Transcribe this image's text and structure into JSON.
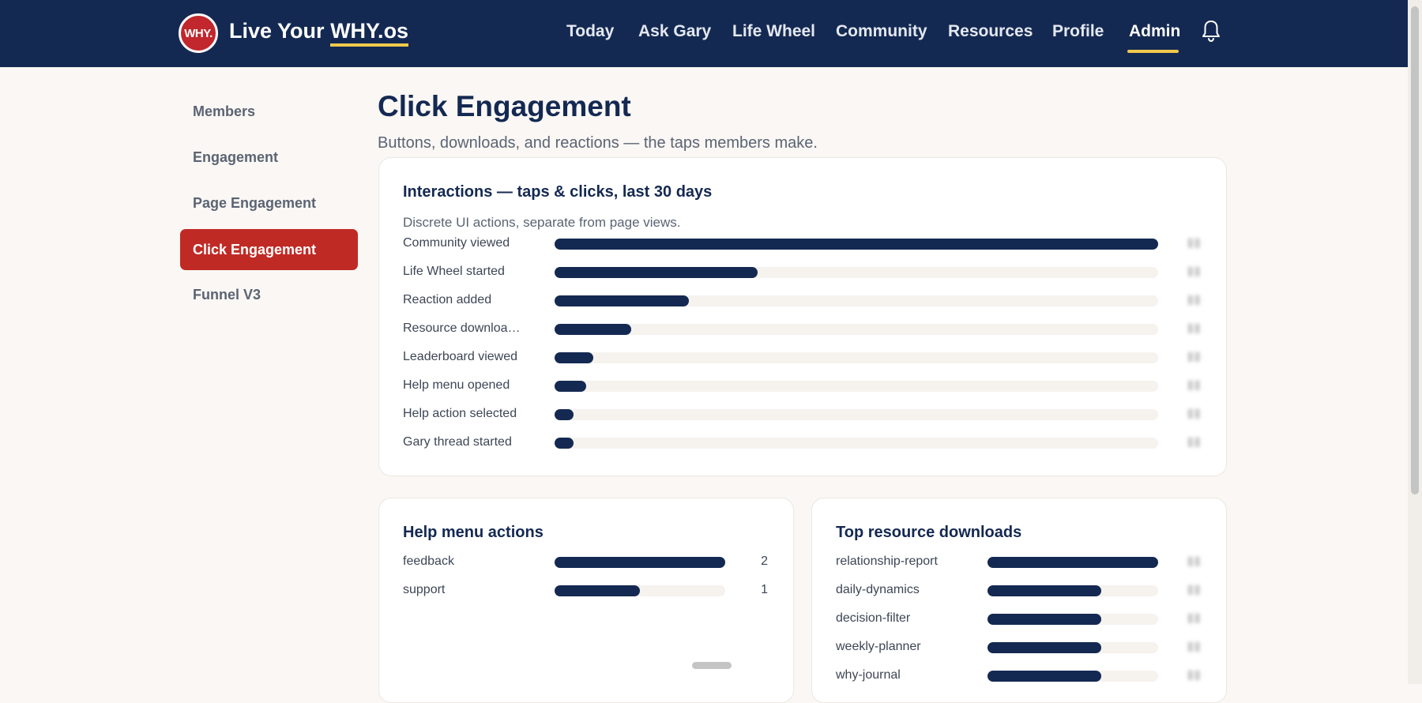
{
  "header": {
    "logo_badge": "WHY.",
    "brand_prefix": "Live Your",
    "brand_underlined": "WHY.os",
    "nav": [
      {
        "label": "Today"
      },
      {
        "label": "Ask Gary"
      },
      {
        "label": "Life Wheel"
      },
      {
        "label": "Community"
      },
      {
        "label": "Resources"
      },
      {
        "label": "Profile"
      },
      {
        "label": "Admin",
        "active": true
      }
    ]
  },
  "sidebar": {
    "items": [
      {
        "label": "Members"
      },
      {
        "label": "Engagement"
      },
      {
        "label": "Page Engagement"
      },
      {
        "label": "Click Engagement",
        "active": true
      },
      {
        "label": "Funnel V3"
      }
    ]
  },
  "page": {
    "title": "Click Engagement",
    "subtitle": "Buttons, downloads, and reactions — the taps members make."
  },
  "interactions_card": {
    "title": "Interactions — taps & clicks, last 30 days",
    "description": "Discrete UI actions, separate from page views.",
    "rows": [
      {
        "label": "Community viewed",
        "fill": 1.0
      },
      {
        "label": "Life Wheel started",
        "fill": 0.337
      },
      {
        "label": "Reaction added",
        "fill": 0.222
      },
      {
        "label": "Resource downloa…",
        "fill": 0.127
      },
      {
        "label": "Leaderboard viewed",
        "fill": 0.064
      },
      {
        "label": "Help menu opened",
        "fill": 0.053
      },
      {
        "label": "Help action selected",
        "fill": 0.032
      },
      {
        "label": "Gary thread started",
        "fill": 0.032
      }
    ]
  },
  "help_card": {
    "title": "Help menu actions",
    "rows": [
      {
        "label": "feedback",
        "value": "2",
        "fill": 1.0
      },
      {
        "label": "support",
        "value": "1",
        "fill": 0.5
      }
    ]
  },
  "downloads_card": {
    "title": "Top resource downloads",
    "rows": [
      {
        "label": "relationship-report",
        "fill": 1.0
      },
      {
        "label": "daily-dynamics",
        "fill": 0.667
      },
      {
        "label": "decision-filter",
        "fill": 0.667
      },
      {
        "label": "weekly-planner",
        "fill": 0.667
      },
      {
        "label": "why-journal",
        "fill": 0.667
      }
    ]
  },
  "colors": {
    "navy": "#142952",
    "accent_red": "#c02a25",
    "gold": "#f2c94c",
    "track": "#f6f2ee"
  },
  "icons": {
    "notifications": "bell-icon"
  }
}
